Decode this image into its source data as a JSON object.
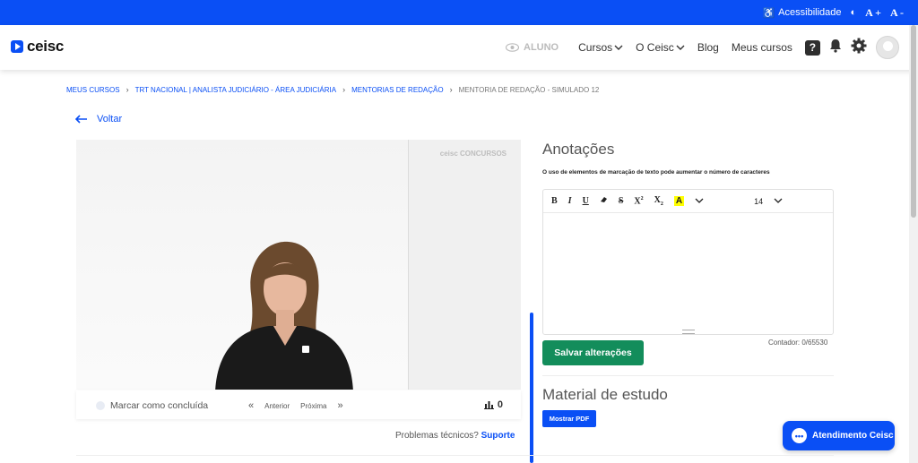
{
  "topbar": {
    "accessibility_label": "Acessibilidade",
    "font_increase": "A +",
    "font_decrease": "A -"
  },
  "nav": {
    "logo": "ceisc",
    "aluno": "ALUNO",
    "cursos": "Cursos",
    "oceisc": "O Ceisc",
    "blog": "Blog",
    "meus_cursos": "Meus cursos",
    "help": "?"
  },
  "breadcrumb": {
    "items": [
      "MEUS CURSOS",
      "TRT NACIONAL | ANALISTA JUDICIÁRIO - ÁREA JUDICIÁRIA",
      "MENTORIAS DE REDAÇÃO"
    ],
    "current": "MENTORIA DE REDAÇÃO - SIMULADO 12"
  },
  "back_label": "Voltar",
  "video": {
    "watermark": "ceisc CONCURSOS"
  },
  "controls": {
    "mark_done": "Marcar como concluída",
    "prev": "Anterior",
    "next": "Próxima",
    "views": "0"
  },
  "support": {
    "text": "Problemas técnicos?",
    "link": "Suporte"
  },
  "notes": {
    "title": "Anotações",
    "hint": "O uso de elementos de marcação de texto pode aumentar o número de caracteres",
    "font_size": "14",
    "counter": "Contador: 0/65530",
    "save": "Salvar alterações"
  },
  "material": {
    "title": "Material de estudo",
    "pdf_button": "Mostrar PDF"
  },
  "chat": {
    "label": "Atendimento Ceisc"
  },
  "colors": {
    "brand_blue": "#0a4ff5",
    "save_green": "#138d5b"
  }
}
